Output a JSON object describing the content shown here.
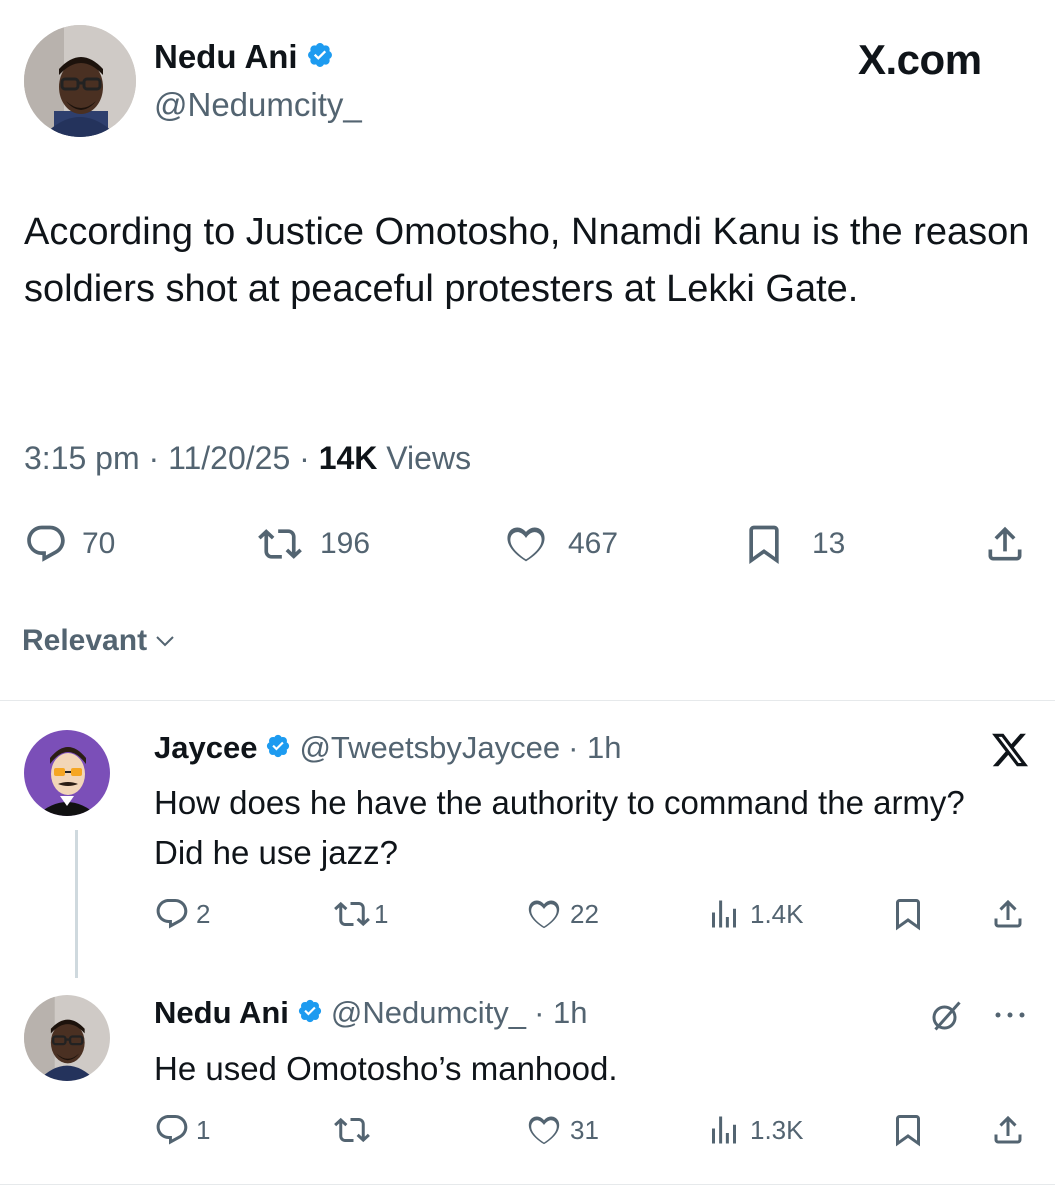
{
  "brand": {
    "watermark": "X.com"
  },
  "main_post": {
    "author_name": "Nedu Ani",
    "handle": "@Nedumcity_",
    "text": "According to Justice Omotosho, Nnamdi Kanu is the reason soldiers shot at peaceful protesters at Lekki Gate.",
    "time": "3:15 pm",
    "date": "11/20/25",
    "views_count": "14K",
    "views_label": "Views",
    "separator": "·",
    "replies": "70",
    "reposts": "196",
    "likes": "467",
    "bookmarks": "13"
  },
  "sort": {
    "label": "Relevant"
  },
  "reply_1": {
    "author_name": "Jaycee",
    "handle": "@TweetsbyJaycee",
    "time": "· 1h",
    "text": "How does he have the authority to command the army?  Did he use jazz?",
    "replies": "2",
    "reposts": "1",
    "likes": "22",
    "views": "1.4K"
  },
  "reply_2": {
    "author_name": "Nedu Ani",
    "handle": "@Nedumcity_",
    "time": "· 1h",
    "text": "He used Omotosho’s manhood.",
    "replies": "1",
    "reposts": "",
    "likes": "31",
    "views": "1.3K"
  },
  "colors": {
    "verified": "#1d9bf0",
    "text": "#0f1419",
    "muted": "#536471",
    "jaycee_bg": "#7b4fb8"
  },
  "icons": [
    "verified-badge-icon",
    "reply-icon",
    "repost-icon",
    "like-icon",
    "bookmark-icon",
    "share-icon",
    "views-icon",
    "x-logo-icon",
    "chevron-down-icon",
    "grok-icon",
    "more-icon"
  ]
}
